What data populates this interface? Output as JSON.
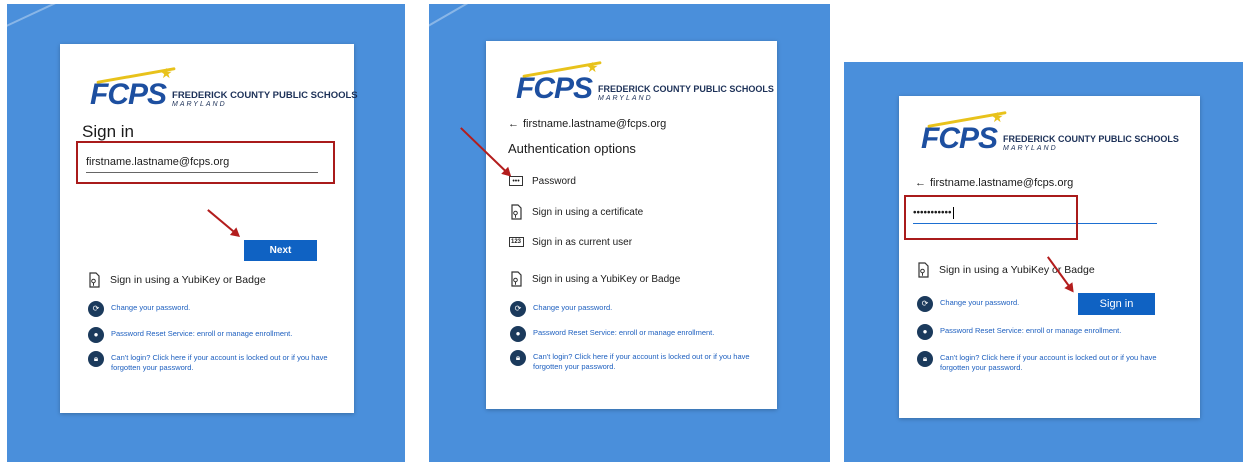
{
  "logo": {
    "mark": "FCPS",
    "name": "FREDERICK COUNTY PUBLIC SCHOOLS",
    "state": "MARYLAND"
  },
  "colors": {
    "background": "#4a8fdb",
    "primary_button": "#0f62c3",
    "highlight": "#a91b1b",
    "link": "#1d5fbf"
  },
  "panel1": {
    "title": "Sign in",
    "email_value": "firstname.lastname@fcps.org",
    "next_label": "Next",
    "yubikey_label": "Sign in using a YubiKey or Badge",
    "links": [
      "Change your password.",
      "Password Reset Service: enroll or manage enrollment.",
      "Can't login? Click here if your account is locked out or if you have forgotten your password."
    ]
  },
  "panel2": {
    "back_email": "firstname.lastname@fcps.org",
    "title": "Authentication options",
    "options": [
      "Password",
      "Sign in using a certificate",
      "Sign in as current user",
      "Sign in using a YubiKey or Badge"
    ],
    "option_icons": [
      "password-dots-icon",
      "certificate-icon",
      "number-123-icon",
      "badge-icon"
    ],
    "password_icon_glyph": "•••",
    "number_icon_glyph": "123",
    "links": [
      "Change your password.",
      "Password Reset Service: enroll or manage enrollment.",
      "Can't login? Click here if your account is locked out or if you have forgotten your password."
    ]
  },
  "panel3": {
    "back_email": "firstname.lastname@fcps.org",
    "password_value": "•••••••••••",
    "yubikey_label": "Sign in using a YubiKey or Badge",
    "signin_label": "Sign in",
    "links": [
      "Change your password.",
      "Password Reset Service: enroll or manage enrollment.",
      "Can't login? Click here if your account is locked out or if you have forgotten your password."
    ]
  }
}
